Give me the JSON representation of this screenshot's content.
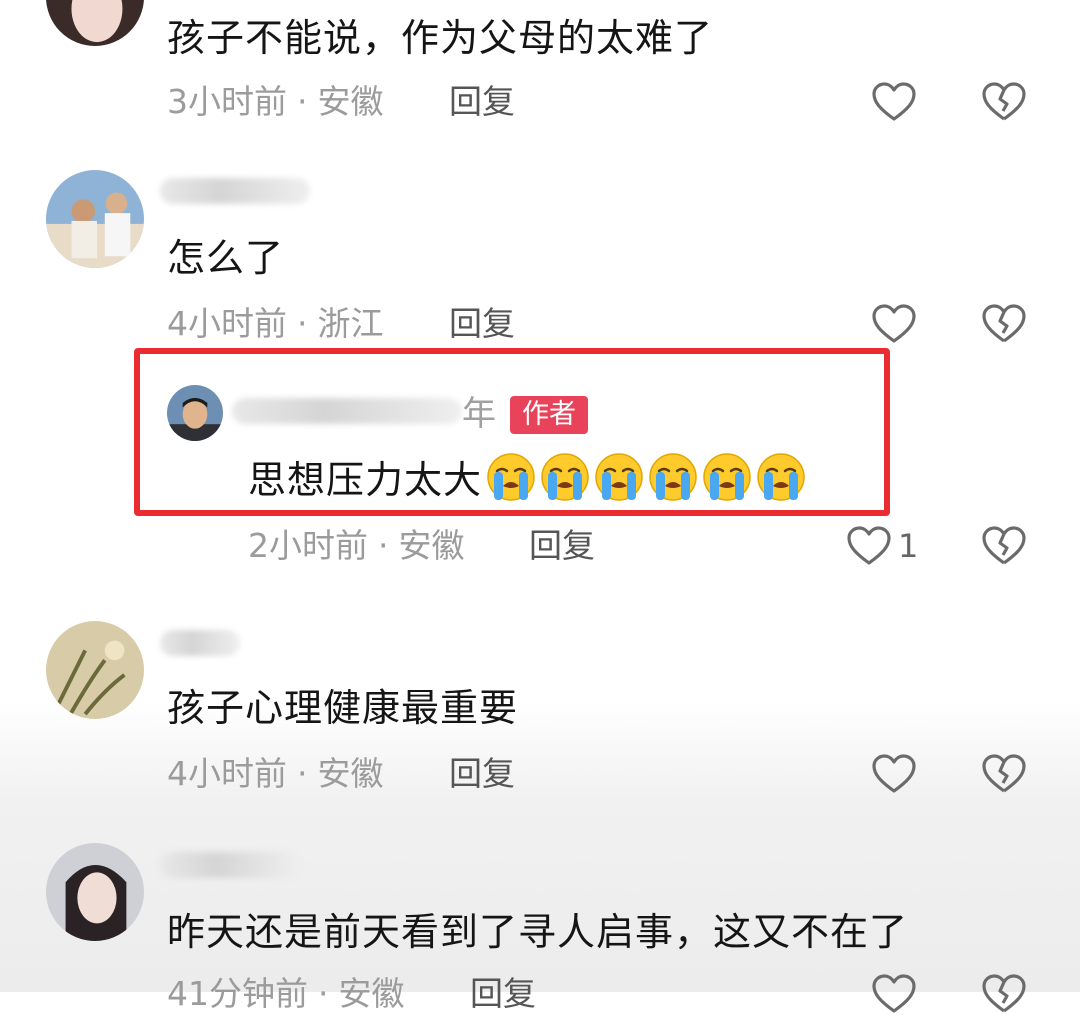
{
  "comments": [
    {
      "text": "孩子不能说，作为父母的太难了",
      "time": "3小时前",
      "location": "安徽",
      "reply_label": "回复"
    },
    {
      "text": "怎么了",
      "time": "4小时前",
      "location": "浙江",
      "reply_label": "回复"
    },
    {
      "author_name_visible": "年",
      "author_badge": "作者",
      "text": "思想压力太大",
      "emoji": [
        "loudly-crying-face",
        "loudly-crying-face",
        "loudly-crying-face",
        "loudly-crying-face",
        "loudly-crying-face",
        "loudly-crying-face"
      ],
      "time": "2小时前",
      "location": "安徽",
      "reply_label": "回复",
      "likes": "1"
    },
    {
      "text": "孩子心理健康最重要",
      "time": "4小时前",
      "location": "安徽",
      "reply_label": "回复"
    },
    {
      "text": "昨天还是前天看到了寻人启事，这又不在了",
      "time": "41分钟前",
      "location": "安徽",
      "reply_label": "回复"
    }
  ],
  "separator": "·",
  "icons": {
    "like": "heart-outline-icon",
    "dislike": "broken-heart-icon"
  },
  "colors": {
    "highlight_border": "#ea2b30",
    "author_badge": "#e8435a",
    "meta_text": "#9b9b9b"
  }
}
